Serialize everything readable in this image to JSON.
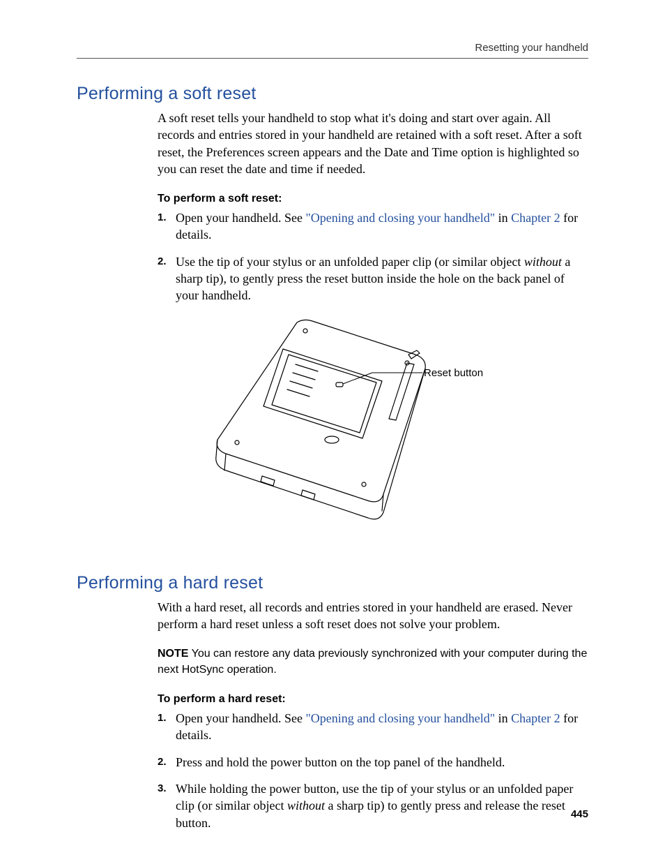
{
  "runningHead": "Resetting your handheld",
  "pageNumber": "445",
  "sections": {
    "soft": {
      "title": "Performing a soft reset",
      "intro": "A soft reset tells your handheld to stop what it's doing and start over again. All records and entries stored in your handheld are retained with a soft reset. After a soft reset, the Preferences screen appears and the Date and Time option is highlighted so you can reset the date and time if needed.",
      "subhead": "To perform a soft reset:",
      "step1_pre": "Open your handheld. See ",
      "step1_link1": "\"Opening and closing your handheld\"",
      "step1_mid": " in ",
      "step1_link2": "Chapter 2",
      "step1_post": " for details.",
      "step2_pre": "Use the tip of your stylus or an unfolded paper clip (or similar object ",
      "step2_em": "without",
      "step2_post": " a sharp tip), to gently press the reset button inside the hole on the back panel of your handheld.",
      "figureCallout": "Reset button"
    },
    "hard": {
      "title": "Performing a hard reset",
      "intro": "With a hard reset, all records and entries stored in your handheld are erased. Never perform a hard reset unless a soft reset does not solve your problem.",
      "noteLabel": "NOTE",
      "noteBody": "   You can restore any data previously synchronized with your computer during the next HotSync operation.",
      "subhead": "To perform a hard reset:",
      "step1_pre": "Open your handheld. See ",
      "step1_link1": "\"Opening and closing your handheld\"",
      "step1_mid": " in ",
      "step1_link2": "Chapter 2",
      "step1_post": " for details.",
      "step2": "Press and hold the power button on the top panel of the handheld.",
      "step3_pre": "While holding the power button, use the tip of your stylus or an unfolded paper clip (or similar object ",
      "step3_em": "without",
      "step3_post": " a sharp tip) to gently press and release the reset button."
    }
  }
}
